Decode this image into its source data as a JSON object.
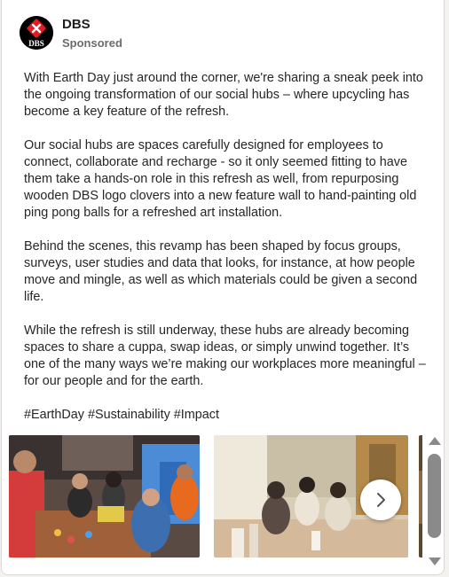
{
  "post": {
    "author": "DBS",
    "subtitle": "Sponsored",
    "logo_text": "DBS",
    "paragraphs": [
      "With Earth Day just around the corner, we're sharing a sneak peek into the ongoing transformation of our social hubs – where upcycling has become a key feature of the refresh.",
      "Our social hubs are spaces carefully designed for employees to connect, collaborate and recharge - so it only seemed fitting to have them take a hands-on role in this refresh as well, from repurposing wooden DBS logo clovers into a new feature wall to hand-painting old ping pong balls for a refreshed art installation.",
      "Behind the scenes, this revamp has been shaped by focus groups, surveys, user studies and data that looks, for instance, at how people move and mingle, as well as which materials could be given a second life.",
      "While the refresh is still underway, these hubs are already becoming spaces to share a cuppa, swap ideas, or simply unwind together. It’s one of the many ways we’re making our workplaces more meaningful – for our people and for the earth."
    ],
    "hashtags": "#EarthDay #Sustainability #Impact"
  },
  "colors": {
    "brand_red": "#e31b23",
    "scrollbar": "#8a8a8a"
  },
  "icons": {
    "next": "chevron-right-icon",
    "scroll_up": "triangle-up-icon",
    "scroll_down": "triangle-down-icon"
  }
}
